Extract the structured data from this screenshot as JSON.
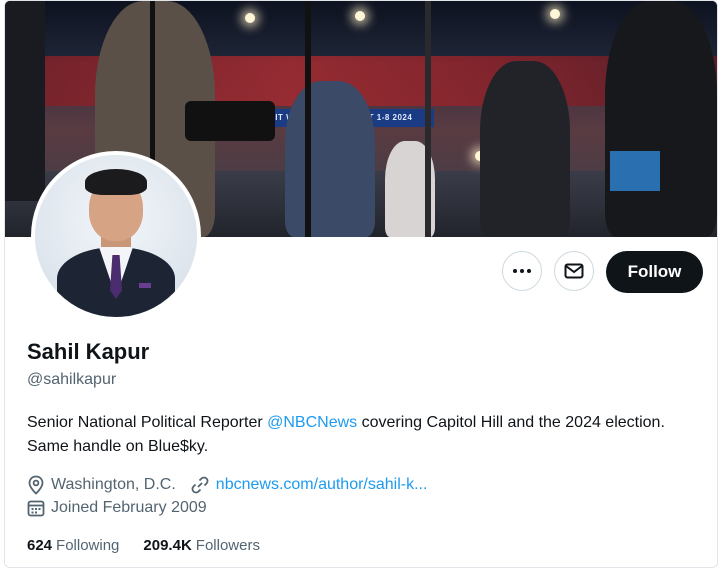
{
  "banner": {
    "sign_text": "AIT W TEST VL OR TEXT 1-8 2024"
  },
  "profile": {
    "name": "Sahil Kapur",
    "handle": "@sahilkapur",
    "bio_before": "Senior National Political Reporter ",
    "bio_mention": "@NBCNews",
    "bio_after": " covering Capitol Hill and the 2024 election. Same handle on Blue$ky.",
    "location": "Washington, D.C.",
    "website": "nbcnews.com/author/sahil-k...",
    "joined": "Joined February 2009"
  },
  "actions": {
    "more_icon": "more-horizontal-icon",
    "message_icon": "envelope-icon",
    "follow_label": "Follow"
  },
  "stats": {
    "following_count": "624",
    "following_label": "Following",
    "followers_count": "209.4K",
    "followers_label": "Followers"
  },
  "colors": {
    "accent": "#1d9bf0",
    "follow_bg": "#0f1419",
    "secondary_text": "#536471"
  }
}
